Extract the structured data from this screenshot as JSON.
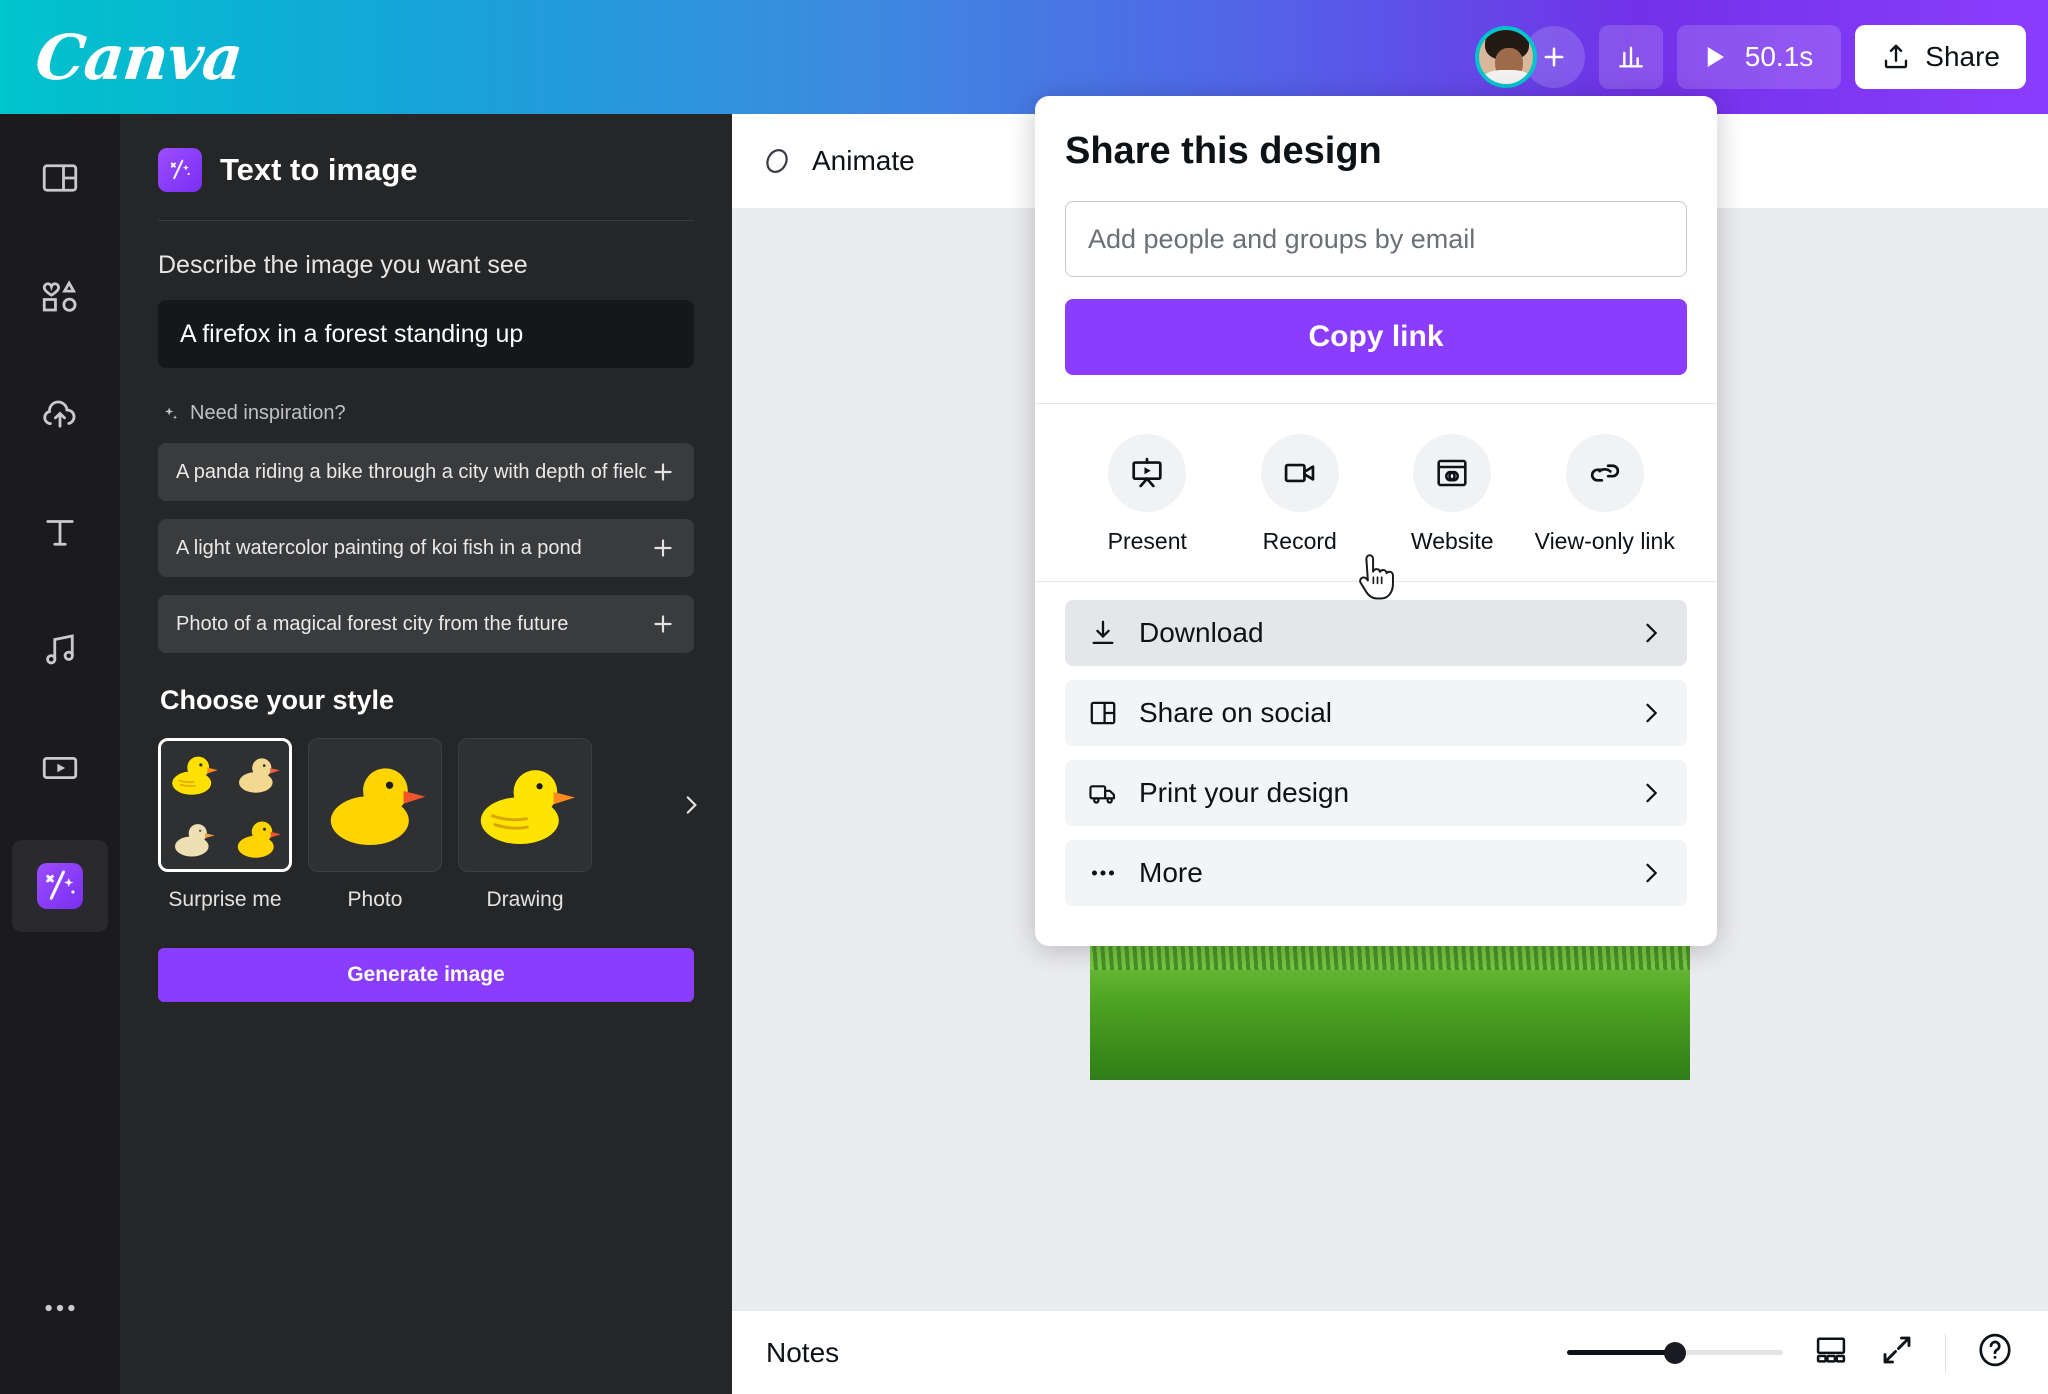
{
  "topbar": {
    "brand": "Canva",
    "add_collaborator_icon": "plus-icon",
    "insights_icon": "bar-chart-icon",
    "play_icon": "play-icon",
    "duration": "50.1s",
    "share_icon": "upload-share-icon",
    "share_label": "Share",
    "avatar_name": "user-avatar"
  },
  "rail": {
    "items": [
      {
        "name": "design",
        "icon": "layout-icon"
      },
      {
        "name": "elements",
        "icon": "shapes-icon"
      },
      {
        "name": "uploads",
        "icon": "cloud-upload-icon"
      },
      {
        "name": "text",
        "icon": "text-t-icon"
      },
      {
        "name": "audio",
        "icon": "music-note-icon"
      },
      {
        "name": "videos",
        "icon": "video-play-icon"
      },
      {
        "name": "apps",
        "icon": "magic-wand-app-icon",
        "active": true
      },
      {
        "name": "more",
        "icon": "ellipsis-icon"
      }
    ]
  },
  "panel": {
    "app_icon": "magic-wand-app-icon",
    "title": "Text to image",
    "prompt_label": "Describe the image you want see",
    "prompt_value": "A firefox in a forest standing up",
    "prompt_placeholder": "Describe the image you want see",
    "inspiration_icon": "sparkles-icon",
    "inspiration_label": "Need inspiration?",
    "suggestions": [
      {
        "text": "A panda riding a bike through a city with depth of field",
        "add_icon": "plus-icon"
      },
      {
        "text": "A light watercolor painting of koi fish in a pond",
        "add_icon": "plus-icon"
      },
      {
        "text": "Photo of a magical forest city from the future",
        "add_icon": "plus-icon"
      }
    ],
    "style_heading": "Choose your style",
    "styles": [
      {
        "label": "Surprise me",
        "selected": true,
        "thumb": "duck-grid"
      },
      {
        "label": "Photo",
        "selected": false,
        "thumb": "duck-photo"
      },
      {
        "label": "Drawing",
        "selected": false,
        "thumb": "duck-drawing"
      }
    ],
    "carousel_next_icon": "chevron-right-icon",
    "generate_label": "Generate image"
  },
  "editor": {
    "animate_icon": "animate-icon",
    "animate_label": "Animate",
    "notes_label": "Notes",
    "zoom_percent": 50,
    "grid_view_icon": "page-grid-icon",
    "fullscreen_icon": "expand-icon",
    "help_icon": "question-mark-icon"
  },
  "share": {
    "title": "Share this design",
    "email_placeholder": "Add people and groups by email",
    "email_value": "",
    "copy_link_label": "Copy link",
    "quick_actions": [
      {
        "label": "Present",
        "icon": "present-screen-icon"
      },
      {
        "label": "Record",
        "icon": "video-camera-icon"
      },
      {
        "label": "Website",
        "icon": "browser-link-icon"
      },
      {
        "label": "View-only link",
        "icon": "chain-link-icon"
      }
    ],
    "menu": [
      {
        "label": "Download",
        "icon": "download-icon",
        "chevron": "chevron-right-icon",
        "hovered": true
      },
      {
        "label": "Share on social",
        "icon": "social-panels-icon",
        "chevron": "chevron-right-icon",
        "hovered": false
      },
      {
        "label": "Print your design",
        "icon": "delivery-truck-icon",
        "chevron": "chevron-right-icon",
        "hovered": false
      },
      {
        "label": "More",
        "icon": "ellipsis-icon",
        "chevron": "chevron-right-icon",
        "hovered": false
      }
    ]
  },
  "colors": {
    "brand_purple": "#8b3dff",
    "brand_teal": "#00c4cc",
    "panel_bg": "#252627",
    "rail_bg": "#1b1b1e",
    "canvas_bg": "#ebecf0"
  }
}
